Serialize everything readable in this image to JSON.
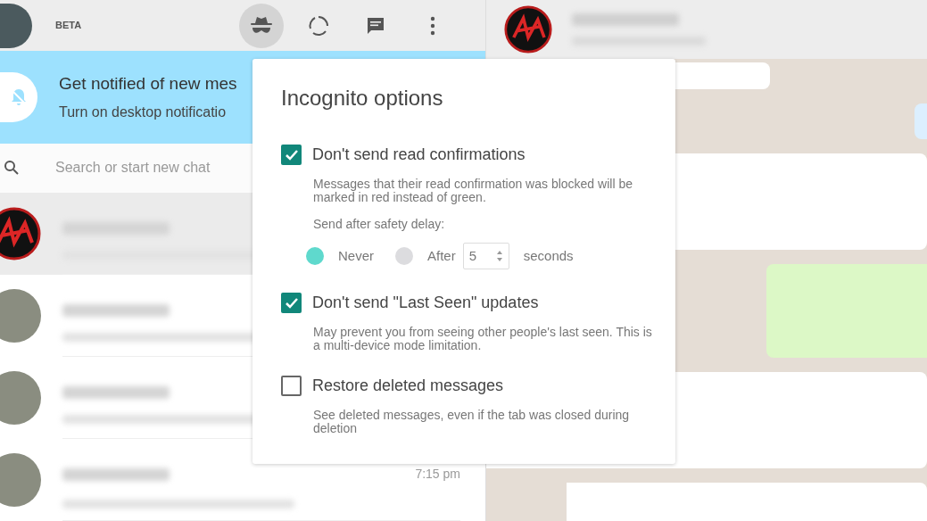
{
  "header": {
    "label": "BETA",
    "icons": [
      {
        "kind": "incognito",
        "selected": true
      },
      {
        "kind": "status",
        "selected": false
      },
      {
        "kind": "chat",
        "selected": false
      },
      {
        "kind": "menu",
        "selected": false
      }
    ]
  },
  "banner": {
    "title": "Get notified of new mes",
    "subtitle": "Turn on desktop notificatio"
  },
  "search": {
    "placeholder": "Search or start new chat"
  },
  "chats": [
    {
      "kind": "logo",
      "selected": true
    },
    {
      "kind": "photo",
      "selected": false
    },
    {
      "kind": "photo",
      "selected": false
    },
    {
      "kind": "photo",
      "selected": false,
      "time": "7:15 pm"
    }
  ],
  "conversation": {
    "kind": "logo",
    "messages": [
      {
        "kind": "in"
      },
      {
        "kind": "out"
      },
      {
        "kind": "in"
      },
      {
        "kind": "out"
      },
      {
        "kind": "in"
      },
      {
        "kind": "in"
      }
    ]
  },
  "popup": {
    "title": "Incognito options",
    "options": [
      {
        "label": "Don't send read confirmations",
        "checked": true,
        "description": "Messages that their read confirmation was blocked will be marked in red instead of green.",
        "delay": {
          "label": "Send after safety delay:",
          "choices": [
            {
              "label": "Never",
              "selected": true
            },
            {
              "label": "After",
              "selected": false
            }
          ],
          "value": "5",
          "unit": "seconds"
        }
      },
      {
        "label": "Don't send \"Last Seen\" updates",
        "checked": true,
        "description": "May prevent you from seeing other people's last seen. This is a multi-device mode limitation."
      },
      {
        "label": "Restore deleted messages",
        "checked": false,
        "description": "See deleted messages, even if the tab was closed during deletion"
      }
    ]
  }
}
